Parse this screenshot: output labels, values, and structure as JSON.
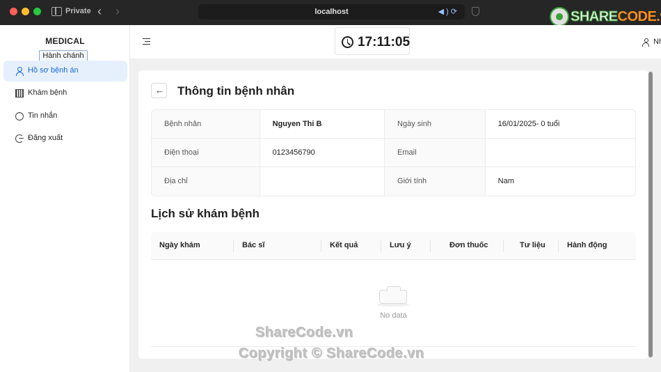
{
  "browser": {
    "private_label": "Private",
    "url": "localhost",
    "brand": "SHARECODE.vn",
    "brand_main": "SHARE",
    "brand_accent": "CODE.vn"
  },
  "sidebar": {
    "title": "MEDICAL",
    "tooltip": "Hành chánh",
    "items": [
      {
        "label": "Hồ sơ bệnh án",
        "icon": "user-icon",
        "active": true
      },
      {
        "label": "Khám bệnh",
        "icon": "barcode-icon",
        "active": false
      },
      {
        "label": "Tin nhắn",
        "icon": "chat-icon",
        "active": false
      },
      {
        "label": "Đăng xuất",
        "icon": "logout-icon",
        "active": false
      }
    ]
  },
  "header": {
    "clock": "17:11:05",
    "user_label": "Nhân viên"
  },
  "patient": {
    "page_title": "Thông tin bệnh nhân",
    "rows": [
      {
        "label1": "Bệnh nhân",
        "value1": "Nguyen Thi B",
        "label2": "Ngày sinh",
        "value2": "16/01/2025- 0 tuổi"
      },
      {
        "label1": "Điện thoại",
        "value1": "0123456790",
        "label2": "Email",
        "value2": ""
      },
      {
        "label1": "Địa chỉ",
        "value1": "",
        "label2": "Giới tính",
        "value2": "Nam"
      }
    ]
  },
  "history": {
    "title": "Lịch sử khám bệnh",
    "columns": [
      "Ngày khám",
      "Bác sĩ",
      "Kết quả",
      "Lưu ý",
      "Đơn thuốc",
      "Tư liệu",
      "Hành động"
    ],
    "rows": [],
    "empty_text": "No data"
  },
  "watermark": {
    "line1": "ShareCode.vn",
    "line2": "Copyright © ShareCode.vn"
  },
  "colors": {
    "accent": "#1568d8",
    "active_bg": "#e6f0fd",
    "brand_green": "#3aa035",
    "brand_orange": "#f88d1c"
  }
}
